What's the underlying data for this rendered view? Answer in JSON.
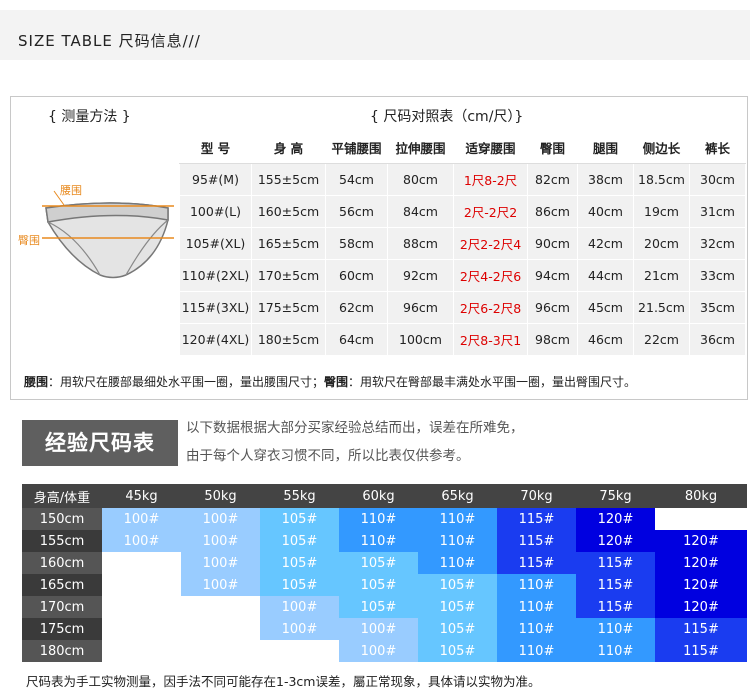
{
  "header": {
    "title": "SIZE TABLE 尺码信息///"
  },
  "measure": {
    "heading": "{ 测量方法 }",
    "waist_label": "腰围",
    "hip_label": "臀围"
  },
  "size_table": {
    "heading": "{ 尺码对照表（cm/尺）}",
    "columns": [
      "型 号",
      "身 高",
      "平铺腰围",
      "拉伸腰围",
      "适穿腰围",
      "臀围",
      "腿围",
      "侧边长",
      "裤长"
    ],
    "rows": [
      [
        "95#(M)",
        "155±5cm",
        "54cm",
        "80cm",
        "1尺8-2尺",
        "82cm",
        "38cm",
        "18.5cm",
        "30cm"
      ],
      [
        "100#(L)",
        "160±5cm",
        "56cm",
        "84cm",
        "2尺-2尺2",
        "86cm",
        "40cm",
        "19cm",
        "31cm"
      ],
      [
        "105#(XL)",
        "165±5cm",
        "58cm",
        "88cm",
        "2尺2-2尺4",
        "90cm",
        "42cm",
        "20cm",
        "32cm"
      ],
      [
        "110#(2XL)",
        "170±5cm",
        "60cm",
        "92cm",
        "2尺4-2尺6",
        "94cm",
        "44cm",
        "21cm",
        "33cm"
      ],
      [
        "115#(3XL)",
        "175±5cm",
        "62cm",
        "96cm",
        "2尺6-2尺8",
        "96cm",
        "45cm",
        "21.5cm",
        "35cm"
      ],
      [
        "120#(4XL)",
        "180±5cm",
        "64cm",
        "100cm",
        "2尺8-3尺1",
        "98cm",
        "46cm",
        "22cm",
        "36cm"
      ]
    ],
    "red_column": 4
  },
  "note": {
    "waist_term": "腰围",
    "waist_text": "：用软尺在腰部最细处水平围一圈，量出腰围尺寸；",
    "hip_term": "臀围",
    "hip_text": "：用软尺在臀部最丰满处水平围一圈，量出臀围尺寸。"
  },
  "experience": {
    "badge": "经验尺码表",
    "line1": "以下数据根据大部分买家经验总结而出，误差在所难免，",
    "line2": "由于每个人穿衣习惯不同，所以比表仅供参考。"
  },
  "grid": {
    "corner": "身高/体重",
    "weights": [
      "45kg",
      "50kg",
      "55kg",
      "60kg",
      "65kg",
      "70kg",
      "75kg",
      "80kg"
    ],
    "heights": [
      "150cm",
      "155cm",
      "160cm",
      "165cm",
      "170cm",
      "175cm",
      "180cm"
    ],
    "cells": [
      [
        "100#",
        "100#",
        "105#",
        "110#",
        "110#",
        "115#",
        "120#",
        ""
      ],
      [
        "100#",
        "100#",
        "105#",
        "110#",
        "110#",
        "115#",
        "120#",
        "120#"
      ],
      [
        "",
        "100#",
        "105#",
        "105#",
        "110#",
        "115#",
        "115#",
        "120#"
      ],
      [
        "",
        "100#",
        "105#",
        "105#",
        "105#",
        "110#",
        "115#",
        "120#"
      ],
      [
        "",
        "",
        "100#",
        "105#",
        "105#",
        "110#",
        "115#",
        "120#"
      ],
      [
        "",
        "",
        "100#",
        "100#",
        "105#",
        "110#",
        "110#",
        "115#"
      ],
      [
        "",
        "",
        "",
        "100#",
        "105#",
        "110#",
        "110#",
        "115#"
      ]
    ],
    "colors": {
      "100#": "#99ccff",
      "105#": "#66c6ff",
      "110#": "#3399ff",
      "115#": "#1a3cf0",
      "120#": "#0000e0"
    }
  },
  "footer": {
    "text": "尺码表为手工实物测量，因手法不同可能存在1-3cm误差，屬正常现象，具体请以实物为准。"
  }
}
